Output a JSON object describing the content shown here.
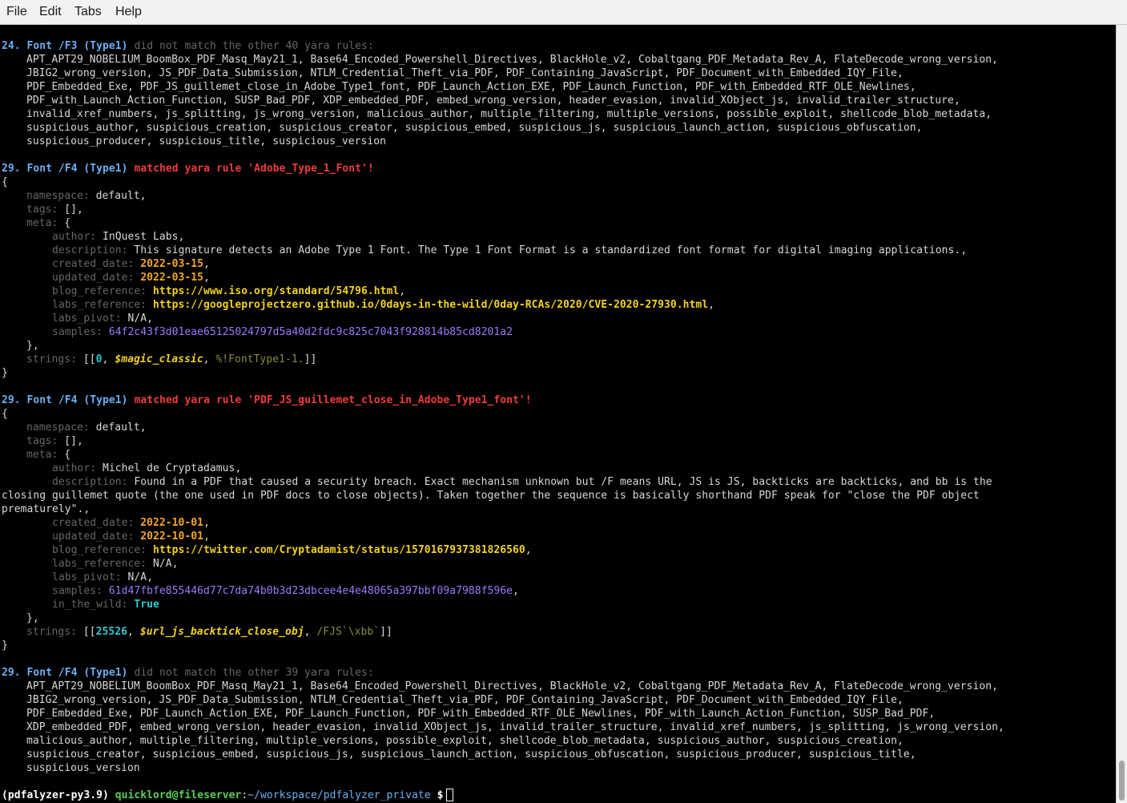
{
  "menu": [
    "File",
    "Edit",
    "Tabs",
    "Help"
  ],
  "block1": {
    "num": "24.",
    "font": "Font /F3 (Type1)",
    "msg": "did not match the other 40 yara rules:",
    "lines": [
      "APT_APT29_NOBELIUM_BoomBox_PDF_Masq_May21_1, Base64_Encoded_Powershell_Directives, BlackHole_v2, Cobaltgang_PDF_Metadata_Rev_A, FlateDecode_wrong_version,",
      "JBIG2_wrong_version, JS_PDF_Data_Submission, NTLM_Credential_Theft_via_PDF, PDF_Containing_JavaScript, PDF_Document_with_Embedded_IQY_File,",
      "PDF_Embedded_Exe, PDF_JS_guillemet_close_in_Adobe_Type1_font, PDF_Launch_Action_EXE, PDF_Launch_Function, PDF_with_Embedded_RTF_OLE_Newlines,",
      "PDF_with_Launch_Action_Function, SUSP_Bad_PDF, XDP_embedded_PDF, embed_wrong_version, header_evasion, invalid_XObject_js, invalid_trailer_structure,",
      "invalid_xref_numbers, js_splitting, js_wrong_version, malicious_author, multiple_filtering, multiple_versions, possible_exploit, shellcode_blob_metadata,",
      "suspicious_author, suspicious_creation, suspicious_creator, suspicious_embed, suspicious_js, suspicious_launch_action, suspicious_obfuscation,",
      "suspicious_producer, suspicious_title, suspicious_version"
    ]
  },
  "block2": {
    "num": "29.",
    "font": "Font /F4 (Type1)",
    "msg": "matched yara rule 'Adobe_Type_1_Font'!",
    "namespace": "default",
    "tags": "[]",
    "author": "InQuest Labs",
    "description": "This signature detects an Adobe Type 1 Font. The Type 1 Font Format is a standardized font format for digital imaging applications.",
    "created_date": "2022-03-15",
    "updated_date": "2022-03-15",
    "blog_reference": "https://www.iso.org/standard/54796.html",
    "labs_reference": "https://googleprojectzero.github.io/0days-in-the-wild/0day-RCAs/2020/CVE-2020-27930.html",
    "labs_pivot": "N/A",
    "samples": "64f2c43f3d01eae65125024797d5a40d2fdc9c825c7043f928814b85cd8201a2",
    "str_num": "0",
    "str_var": "$magic_classic",
    "str_val": "%!FontType1-1."
  },
  "block3": {
    "num": "29.",
    "font": "Font /F4 (Type1)",
    "msg": "matched yara rule 'PDF_JS_guillemet_close_in_Adobe_Type1_font'!",
    "namespace": "default",
    "tags": "[]",
    "author": "Michel de Cryptadamus",
    "description_l1": "Found in a PDF that caused a security breach. Exact mechanism unknown but /F means URL, JS is JS, backticks are backticks, and bb is the",
    "description_l2": "closing guillemet quote (the one used in PDF docs to close objects). Taken together the sequence is basically shorthand PDF speak for \"close the PDF object",
    "description_l3": "prematurely\".,",
    "created_date": "2022-10-01",
    "updated_date": "2022-10-01",
    "blog_reference": "https://twitter.com/Cryptadamist/status/1570167937381826560",
    "labs_reference": "N/A",
    "labs_pivot": "N/A",
    "samples": "61d47fbfe855446d77c7da74b0b3d23dbcee4e4e48065a397bbf09a7988f596e",
    "in_the_wild": "True",
    "str_num": "25526",
    "str_var": "$url_js_backtick_close_obj",
    "str_val": "/FJS`\\xbb`"
  },
  "block4": {
    "num": "29.",
    "font": "Font /F4 (Type1)",
    "msg": "did not match the other 39 yara rules:",
    "lines": [
      "APT_APT29_NOBELIUM_BoomBox_PDF_Masq_May21_1, Base64_Encoded_Powershell_Directives, BlackHole_v2, Cobaltgang_PDF_Metadata_Rev_A, FlateDecode_wrong_version,",
      "JBIG2_wrong_version, JS_PDF_Data_Submission, NTLM_Credential_Theft_via_PDF, PDF_Containing_JavaScript, PDF_Document_with_Embedded_IQY_File,",
      "PDF_Embedded_Exe, PDF_Launch_Action_EXE, PDF_Launch_Function, PDF_with_Embedded_RTF_OLE_Newlines, PDF_with_Launch_Action_Function, SUSP_Bad_PDF,",
      "XDP_embedded_PDF, embed_wrong_version, header_evasion, invalid_XObject_js, invalid_trailer_structure, invalid_xref_numbers, js_splitting, js_wrong_version,",
      "malicious_author, multiple_filtering, multiple_versions, possible_exploit, shellcode_blob_metadata, suspicious_author, suspicious_creation,",
      "suspicious_creator, suspicious_embed, suspicious_js, suspicious_launch_action, suspicious_obfuscation, suspicious_producer, suspicious_title,",
      "suspicious_version"
    ]
  },
  "prompt": {
    "env": "(pdfalyzer-py3.9)",
    "user": "quicklord@fileserver",
    "sep": ":",
    "path": "~/workspace/pdfalyzer_private",
    "symbol": "$"
  }
}
